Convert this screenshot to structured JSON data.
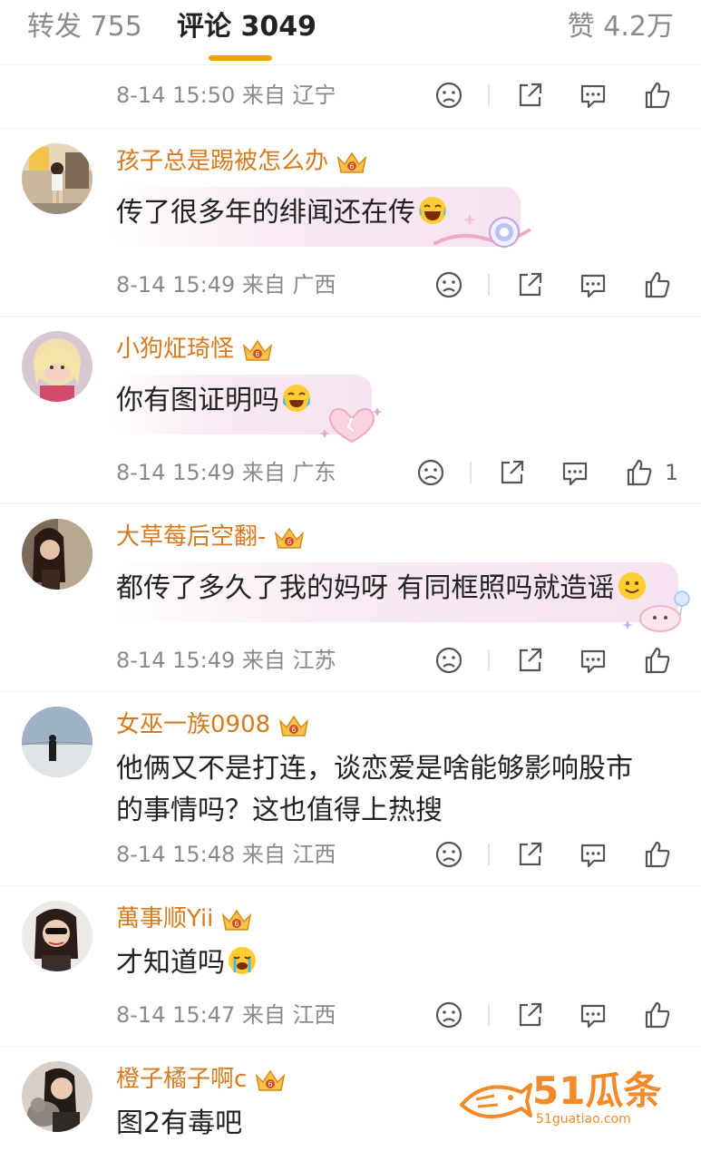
{
  "tabs": {
    "repost": "转发 755",
    "comments": "评论 3049",
    "likes": "赞 4.2万"
  },
  "first_meta": {
    "time": "8-14 15:50",
    "location": "来自 辽宁"
  },
  "comments": [
    {
      "username": "孩子总是踢被怎么办",
      "text": "传了很多年的绯闻还在传",
      "emoji": "laugh-tears-emoji",
      "time": "8-14 15:49",
      "location": "来自 广西",
      "likes": ""
    },
    {
      "username": "小狗炡琦怪",
      "text": "你有图证明吗",
      "emoji": "laugh-cry-emoji",
      "time": "8-14 15:49",
      "location": "来自 广东",
      "likes": "1"
    },
    {
      "username": "大草莓后空翻-",
      "text": "都传了多久了我的妈呀 有同框照吗就造谣",
      "emoji": "smile-emoji",
      "time": "8-14 15:49",
      "location": "来自 江苏",
      "likes": ""
    },
    {
      "username": "女巫一族0908",
      "text_line1": "他俩又不是打连，谈恋爱是啥能够影响股市",
      "text_line2": "的事情吗？这也值得上热搜",
      "time": "8-14 15:48",
      "location": "来自 江西",
      "likes": ""
    },
    {
      "username": "萬事顺Yii",
      "text": "才知道吗",
      "emoji": "crying-emoji",
      "time": "8-14 15:47",
      "location": "来自 江西",
      "likes": ""
    },
    {
      "username": "橙子橘子啊c",
      "text": "图2有毒吧"
    }
  ],
  "watermark": {
    "brand": "51瓜条",
    "url": "51guatiao.com"
  },
  "colors": {
    "accent": "#f7a400",
    "username": "#d67a1f",
    "meta": "#8a8a8a",
    "watermark": "#f38a2a"
  }
}
